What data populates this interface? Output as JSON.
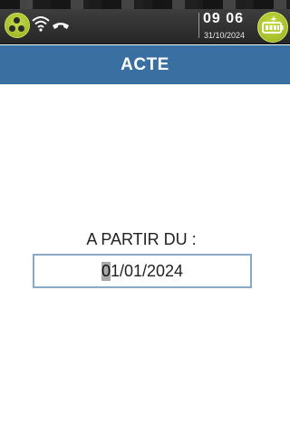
{
  "status_bar": {
    "time": "09 06",
    "date": "31/10/2024",
    "icons": [
      "radio-signal-icon",
      "wifi-icon",
      "phone-icon",
      "battery-charging-icon"
    ]
  },
  "header": {
    "title": "ACTE",
    "color": "#3a6fa2"
  },
  "form": {
    "label": "A PARTIR DU :",
    "date_field": {
      "value": "01/01/2024",
      "cursor_char": "0",
      "rest": "1/01/2024"
    }
  },
  "colors": {
    "accent_green": "#a6bf2c",
    "field_border": "#8aa9c7"
  }
}
